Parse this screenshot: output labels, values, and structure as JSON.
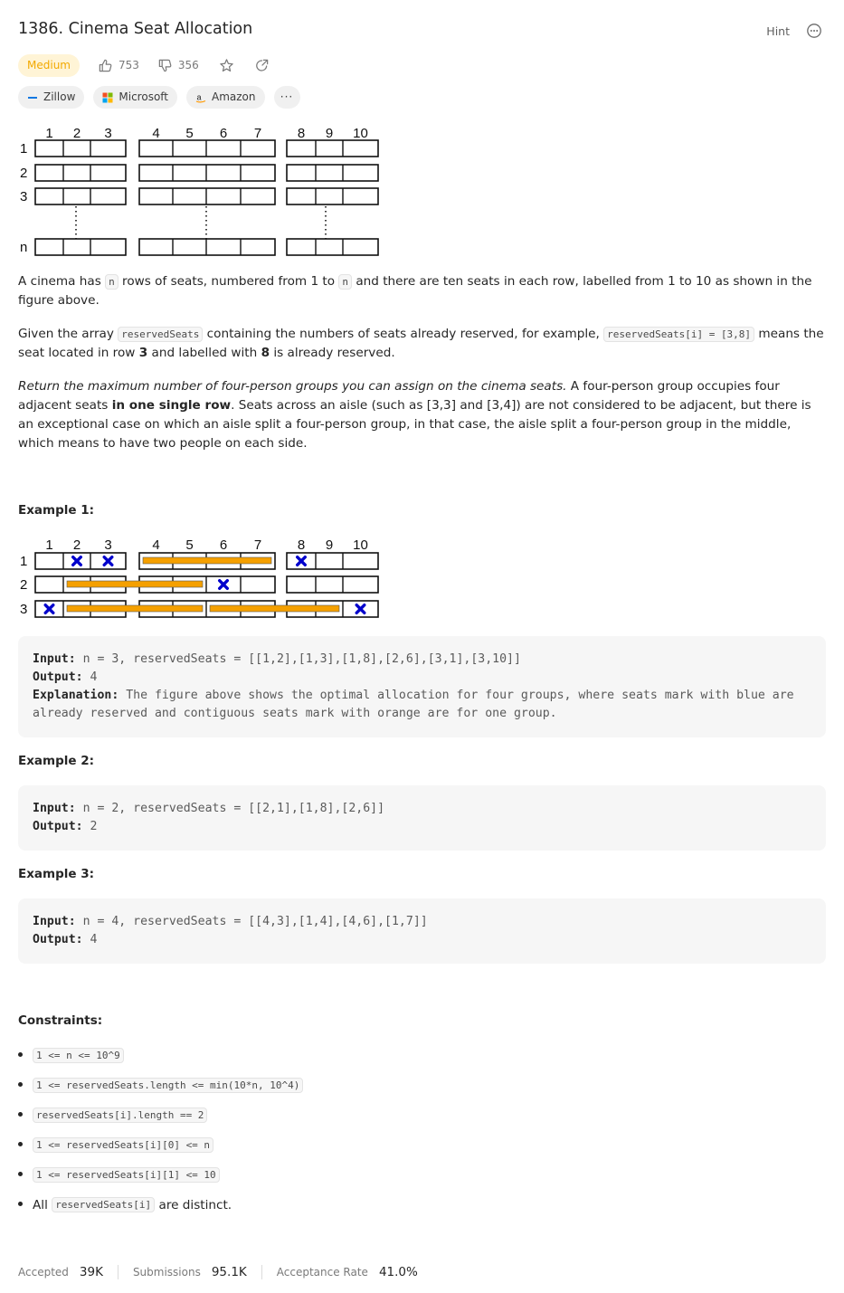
{
  "problem": {
    "title": "1386. Cinema Seat Allocation",
    "hint_label": "Hint",
    "difficulty": "Medium",
    "likes": "753",
    "dislikes": "356"
  },
  "tags": [
    {
      "label": "Zillow"
    },
    {
      "label": "Microsoft"
    },
    {
      "label": "Amazon"
    },
    {
      "label": "···"
    }
  ],
  "figure_top": {
    "column_labels": [
      "1",
      "2",
      "3",
      "4",
      "5",
      "6",
      "7",
      "8",
      "9",
      "10"
    ],
    "row_labels": [
      "1",
      "2",
      "3",
      "n"
    ]
  },
  "description": {
    "p1_a": "A cinema has ",
    "p1_code1": "n",
    "p1_b": " rows of seats, numbered from 1 to ",
    "p1_code2": "n",
    "p1_c": " and there are ten seats in each row, labelled from 1 to 10 as shown in the figure above.",
    "p2_a": "Given the array ",
    "p2_code1": "reservedSeats",
    "p2_b": " containing the numbers of seats already reserved, for example, ",
    "p2_code2": "reservedSeats[i] = [3,8]",
    "p2_c": " means the seat located in row ",
    "p2_bold1": "3",
    "p2_d": " and labelled with ",
    "p2_bold2": "8",
    "p2_e": " is already reserved.",
    "p3_italic": "Return the maximum number of four-person groups you can assign on the cinema seats.",
    "p3_a": " A four-person group occupies four adjacent seats ",
    "p3_bold": "in one single row",
    "p3_b": ". Seats across an aisle (such as [3,3] and [3,4]) are not considered to be adjacent, but there is an exceptional case on which an aisle split a four-person group, in that case, the aisle split a four-person group in the middle, which means to have two people on each side."
  },
  "example1": {
    "heading": "Example 1:",
    "column_labels": [
      "1",
      "2",
      "3",
      "4",
      "5",
      "6",
      "7",
      "8",
      "9",
      "10"
    ],
    "row_labels": [
      "1",
      "2",
      "3"
    ],
    "input_label": "Input:",
    "input_value": "n = 3, reservedSeats = [[1,2],[1,3],[1,8],[2,6],[3,1],[3,10]]",
    "output_label": "Output:",
    "output_value": "4",
    "explanation_label": "Explanation:",
    "explanation_value": "The figure above shows the optimal allocation for four groups, where seats mark with blue are already reserved and contiguous seats mark with orange are for one group."
  },
  "example2": {
    "heading": "Example 2:",
    "input_label": "Input:",
    "input_value": "n = 2, reservedSeats = [[2,1],[1,8],[2,6]]",
    "output_label": "Output:",
    "output_value": "2"
  },
  "example3": {
    "heading": "Example 3:",
    "input_label": "Input:",
    "input_value": "n = 4, reservedSeats = [[4,3],[1,4],[4,6],[1,7]]",
    "output_label": "Output:",
    "output_value": "4"
  },
  "constraints": {
    "heading": "Constraints:",
    "items": [
      "1 <= n <= 10^9",
      "1 <= reservedSeats.length <= min(10*n, 10^4)",
      "reservedSeats[i].length == 2",
      "1 <= reservedSeats[i][0] <= n",
      "1 <= reservedSeats[i][1] <= 10"
    ],
    "last_a": "All ",
    "last_code": "reservedSeats[i]",
    "last_b": " are distinct."
  },
  "stats": {
    "accepted_label": "Accepted",
    "accepted_value": "39K",
    "submissions_label": "Submissions",
    "submissions_value": "95.1K",
    "rate_label": "Acceptance Rate",
    "rate_value": "41.0%"
  },
  "colors": {
    "reserved_marker": "#0000cc",
    "group_bar": "#f5a000",
    "difficulty_text": "#f2a900",
    "difficulty_bg": "#fff4d6"
  },
  "icons": {
    "like": "thumbs-up-icon",
    "dislike": "thumbs-down-icon",
    "favorite": "star-icon",
    "share": "share-icon",
    "more": "more-icon"
  }
}
